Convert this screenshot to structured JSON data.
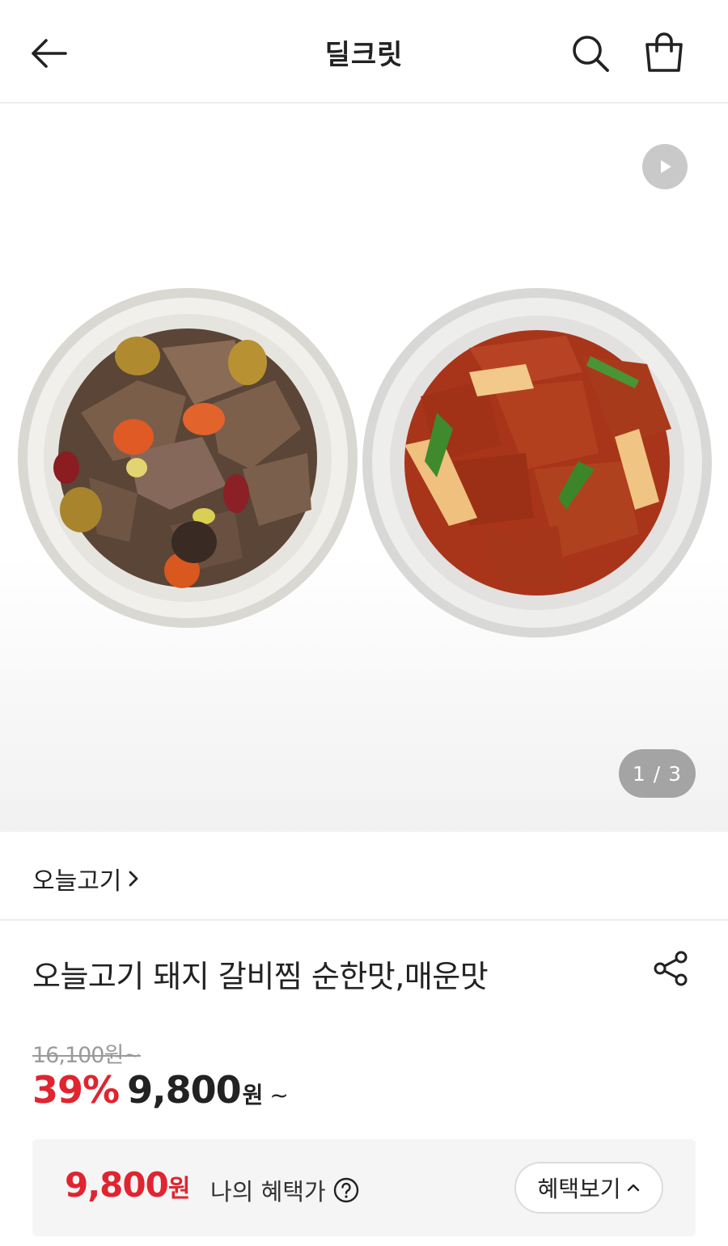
{
  "header": {
    "title": "딜크릿",
    "back_icon": "arrow-left-icon",
    "search_icon": "search-icon",
    "cart_icon": "shopping-bag-icon"
  },
  "hero": {
    "pager_text": "1 / 3",
    "video_icon": "play-icon"
  },
  "brand": {
    "name": "오늘고기"
  },
  "product": {
    "title": "오늘고기 돼지 갈비찜 순한맛,매운맛",
    "share_icon": "share-icon",
    "original_price": "16,100원~",
    "discount_rate": "39%",
    "sale_price": "9,800",
    "sale_unit": "원",
    "sale_suffix": "~"
  },
  "benefit": {
    "price": "9,800",
    "unit": "원",
    "label": "나의 혜택가",
    "help_icon": "question-circle-icon",
    "button_label": "혜택보기",
    "button_icon": "chevron-up-icon"
  },
  "colors": {
    "accent_red": "#e02430",
    "text": "#222222",
    "muted": "#9a9a9a",
    "benefit_bg": "#f5f5f5"
  }
}
